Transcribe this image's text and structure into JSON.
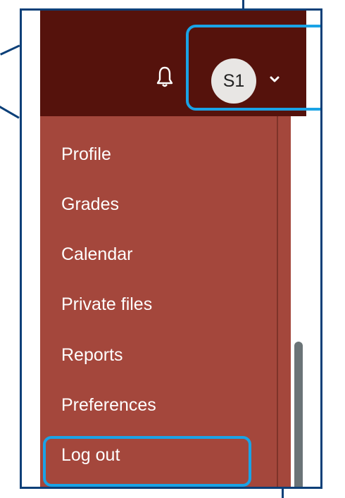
{
  "user": {
    "initials": "S1"
  },
  "menu": {
    "items": [
      {
        "label": "Profile"
      },
      {
        "label": "Grades"
      },
      {
        "label": "Calendar"
      },
      {
        "label": "Private files"
      },
      {
        "label": "Reports"
      },
      {
        "label": "Preferences"
      },
      {
        "label": "Log out"
      }
    ]
  },
  "icons": {
    "notifications": "bell-icon",
    "user_menu_toggle": "chevron-down-icon"
  },
  "colors": {
    "header": "#55120c",
    "menu": "#a4473c",
    "highlight": "#1aa3e6",
    "callout_frame": "#0b3f78"
  }
}
